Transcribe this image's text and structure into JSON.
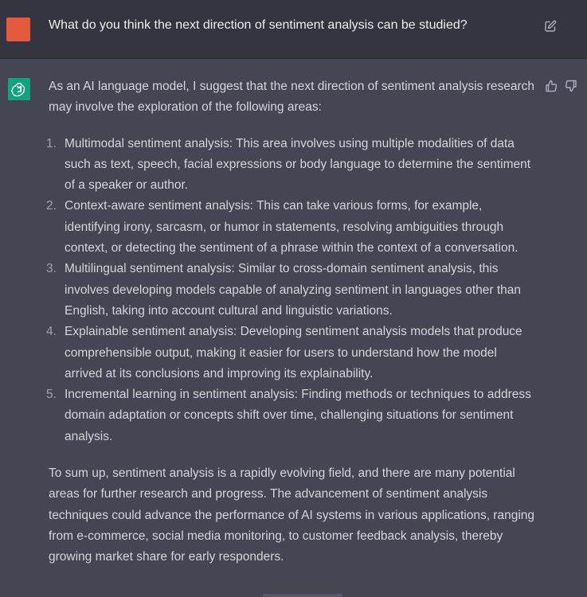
{
  "user_message": {
    "text": "What do you think the next direction of sentiment analysis can be studied?",
    "avatar_color": "#e55a3c",
    "edit_icon": "edit-icon"
  },
  "assistant_message": {
    "avatar_icon": "openai-logo-icon",
    "avatar_color": "#10a37f",
    "intro": "As an AI language model, I suggest that the next direction of sentiment analysis research may involve the exploration of the following areas:",
    "items": [
      {
        "number": "1.",
        "text": "Multimodal sentiment analysis: This area involves using multiple modalities of data such as text, speech, facial expressions or body language to determine the sentiment of a speaker or author."
      },
      {
        "number": "2.",
        "text": "Context-aware sentiment analysis: This can take various forms, for example, identifying irony, sarcasm, or humor in statements, resolving ambiguities through context, or detecting the sentiment of a phrase within the context of a conversation."
      },
      {
        "number": "3.",
        "text": "Multilingual sentiment analysis: Similar to cross-domain sentiment analysis, this involves developing models capable of analyzing sentiment in languages other than English, taking into account cultural and linguistic variations."
      },
      {
        "number": "4.",
        "text": "Explainable sentiment analysis: Developing sentiment analysis models that produce comprehensible output, making it easier for users to understand how the model arrived at its conclusions and improving its explainability."
      },
      {
        "number": "5.",
        "text": "Incremental learning in sentiment analysis: Finding methods or techniques to address domain adaptation or concepts shift over time, challenging situations for sentiment analysis."
      }
    ],
    "outro": "To sum up, sentiment analysis is a rapidly evolving field, and there are many potential areas for further research and progress. The advancement of sentiment analysis techniques could advance the performance of AI systems in various applications, ranging from e-commerce, social media monitoring, to customer feedback analysis, thereby growing market share for early responders.",
    "feedback_icons": [
      "thumbs-up-icon",
      "thumbs-down-icon"
    ]
  },
  "colors": {
    "user_row_bg": "#343541",
    "assistant_row_bg": "#444654",
    "text": "#d1d5db"
  }
}
